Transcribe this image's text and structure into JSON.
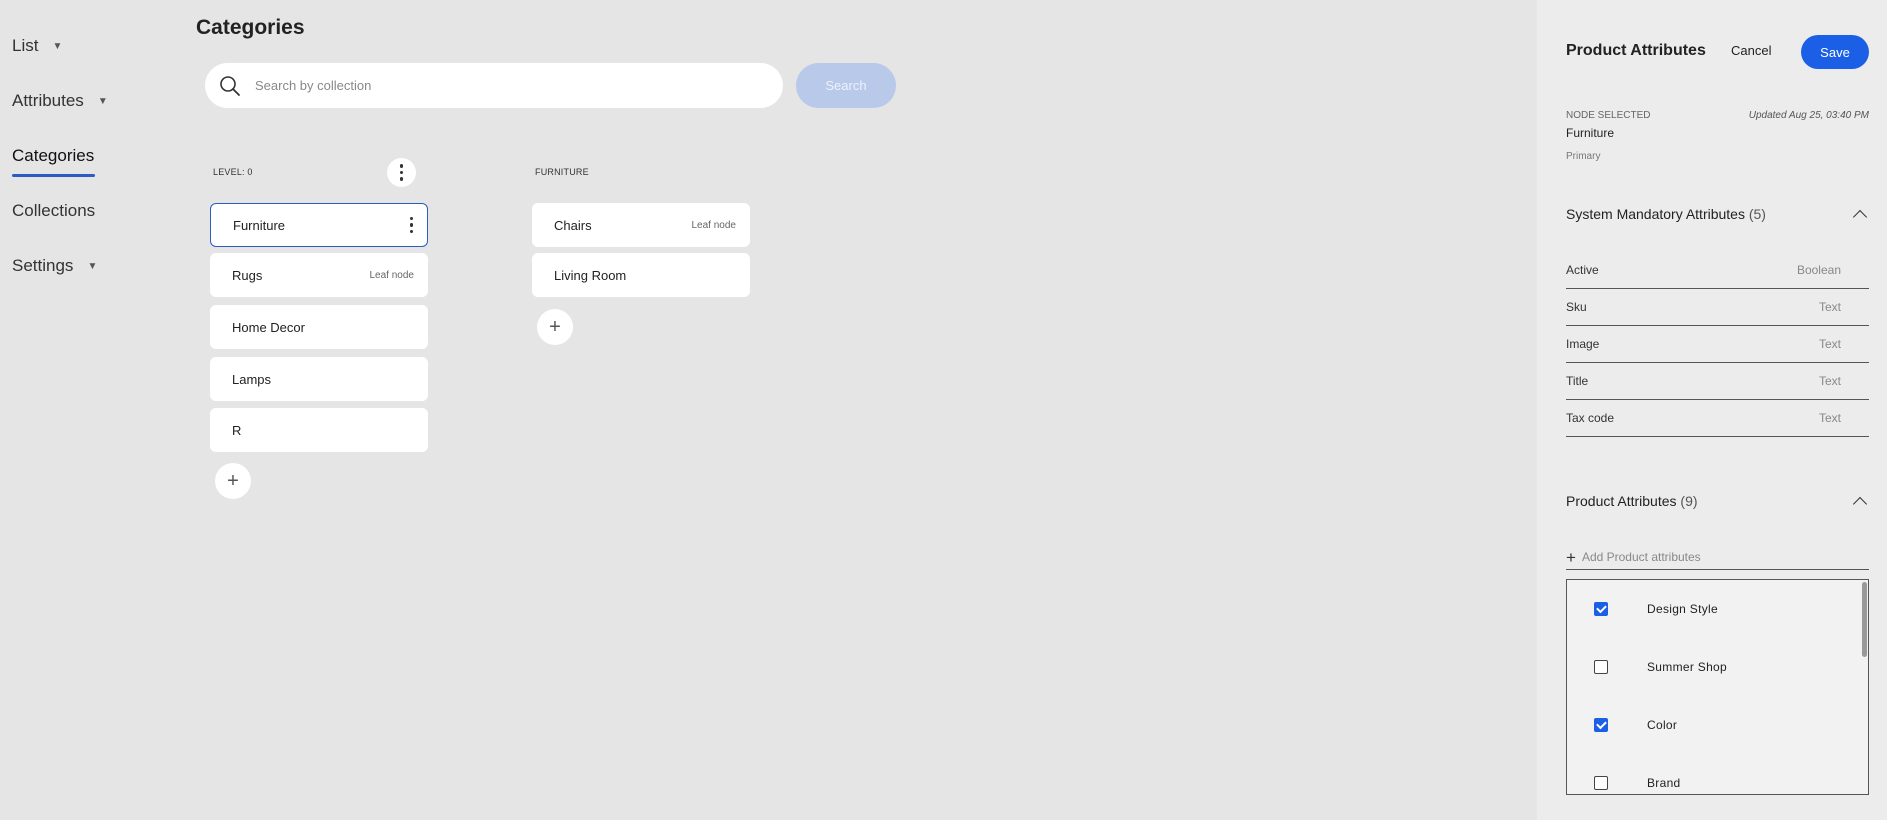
{
  "sidebar": {
    "items": [
      {
        "label": "List",
        "has_caret": true
      },
      {
        "label": "Attributes",
        "has_caret": true
      },
      {
        "label": "Categories",
        "active": true
      },
      {
        "label": "Collections"
      },
      {
        "label": "Settings",
        "has_caret": true
      }
    ]
  },
  "main": {
    "title": "Categories",
    "search": {
      "placeholder": "Search by collection",
      "value": "",
      "button_label": "Search"
    },
    "columns": [
      {
        "header": "LEVEL: 0",
        "items": [
          {
            "name": "Furniture",
            "selected": true,
            "tag": ""
          },
          {
            "name": "Rugs",
            "tag": "Leaf node"
          },
          {
            "name": "Home Decor",
            "tag": ""
          },
          {
            "name": "Lamps",
            "tag": ""
          },
          {
            "name": "R",
            "tag": ""
          }
        ]
      },
      {
        "header": "FURNITURE",
        "items": [
          {
            "name": "Chairs",
            "tag": "Leaf node"
          },
          {
            "name": "Living Room",
            "tag": ""
          }
        ]
      }
    ],
    "add_symbol": "+"
  },
  "panel": {
    "title": "Product Attributes",
    "cancel_label": "Cancel",
    "save_label": "Save",
    "node_selected_label": "NODE SELECTED",
    "node_name": "Furniture",
    "node_type": "Primary",
    "updated": "Updated Aug 25, 03:40 PM",
    "system_section": {
      "title": "System Mandatory Attributes",
      "count": "(5)",
      "attributes": [
        {
          "name": "Active",
          "type": "Boolean"
        },
        {
          "name": "Sku",
          "type": "Text"
        },
        {
          "name": "Image",
          "type": "Text"
        },
        {
          "name": "Title",
          "type": "Text"
        },
        {
          "name": "Tax code",
          "type": "Text"
        }
      ]
    },
    "product_section": {
      "title": "Product Attributes",
      "count": "(9)",
      "add_placeholder": "Add Product attributes",
      "options": [
        {
          "label": "Design Style",
          "checked": true
        },
        {
          "label": "Summer Shop",
          "checked": false
        },
        {
          "label": "Color",
          "checked": true
        },
        {
          "label": "Brand",
          "checked": false
        }
      ]
    }
  },
  "colors": {
    "accent": "#1b5fe6",
    "selected_border": "#2a5cc4",
    "background": "#e5e5e5"
  }
}
